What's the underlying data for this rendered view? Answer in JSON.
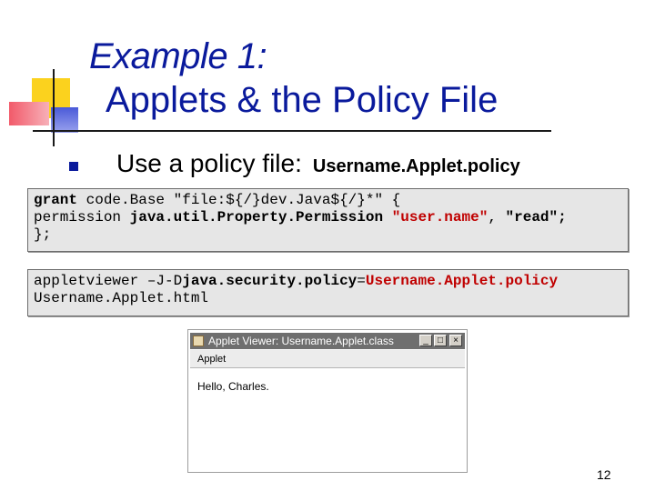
{
  "slide": {
    "title_line1": "Example 1:",
    "title_line2": "Applets & the Policy File",
    "bullet_text": "Use a policy file:",
    "bullet_filename": "Username.Applet.policy",
    "page_number": "12",
    "accent_color": "#0a1a9c"
  },
  "code_block_1": {
    "line1_kw": "grant",
    "line1_rest": " code.Base \"file:${/}dev.Java${/}*\" {",
    "line2_pre": "permission ",
    "line2_bold": "java.util.Property.Permission",
    "line2_space": " ",
    "line2_red": "\"user.name\"",
    "line2_post": ", ",
    "line2_bold2": "\"read\";",
    "line3": "};"
  },
  "code_block_2": {
    "line1_pre": "appletviewer –J-D",
    "line1_bold": "java.security.policy",
    "line1_eq": "=",
    "line1_red": "Username.Applet.policy",
    "line2": "Username.Applet.html"
  },
  "applet_window": {
    "title": "Applet Viewer: Username.Applet.class",
    "menu_label": "Applet",
    "body_text": "Hello, Charles.",
    "min_glyph": "_",
    "max_glyph": "□",
    "close_glyph": "×"
  }
}
